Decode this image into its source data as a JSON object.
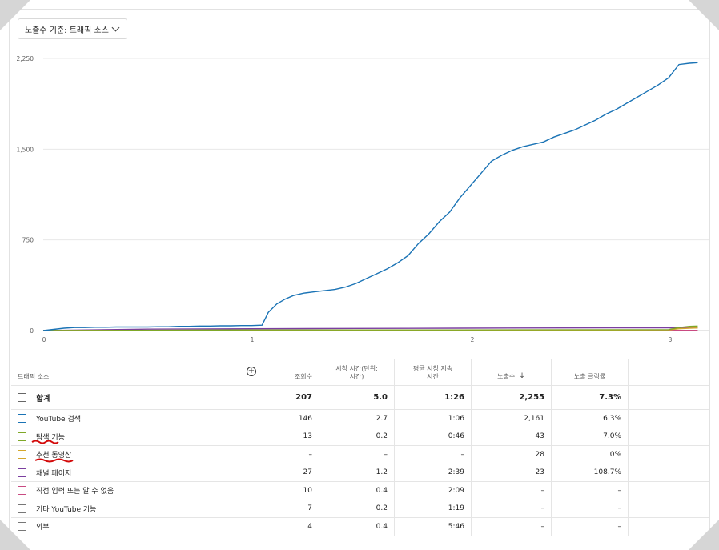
{
  "dropdown": {
    "label": "노출수 기준: 트래픽 소스"
  },
  "chart_data": {
    "type": "line",
    "y_ticks": [
      "2,250",
      "1,500",
      "750",
      "0"
    ],
    "x_ticks": [
      "0",
      "1",
      "2",
      "3"
    ],
    "ylim": [
      0,
      2250
    ],
    "xlim": [
      0,
      3.15
    ],
    "grid": true,
    "series": [
      {
        "key": "youtube_search",
        "color": "#1a73b5",
        "x": [
          0,
          0.05,
          0.1,
          0.15,
          0.2,
          0.25,
          0.3,
          0.35,
          0.4,
          0.45,
          0.5,
          0.55,
          0.6,
          0.65,
          0.7,
          0.75,
          0.8,
          0.85,
          0.9,
          0.95,
          1.0,
          1.05,
          1.08,
          1.12,
          1.16,
          1.2,
          1.25,
          1.3,
          1.35,
          1.4,
          1.45,
          1.5,
          1.55,
          1.6,
          1.65,
          1.7,
          1.75,
          1.8,
          1.85,
          1.9,
          1.95,
          2.0,
          2.05,
          2.1,
          2.15,
          2.2,
          2.25,
          2.3,
          2.35,
          2.4,
          2.45,
          2.5,
          2.55,
          2.6,
          2.65,
          2.7,
          2.75,
          2.8,
          2.85,
          2.9,
          2.95,
          3.0,
          3.05,
          3.1,
          3.14
        ],
        "y": [
          0,
          10,
          20,
          25,
          25,
          28,
          28,
          30,
          30,
          30,
          30,
          32,
          32,
          35,
          35,
          38,
          38,
          40,
          40,
          42,
          42,
          45,
          150,
          220,
          260,
          290,
          310,
          320,
          330,
          340,
          360,
          390,
          430,
          470,
          510,
          560,
          620,
          720,
          800,
          900,
          980,
          1100,
          1200,
          1300,
          1400,
          1450,
          1490,
          1520,
          1540,
          1560,
          1600,
          1630,
          1660,
          1700,
          1740,
          1790,
          1830,
          1880,
          1930,
          1980,
          2030,
          2090,
          2200,
          2210,
          2215
        ]
      },
      {
        "key": "browse_features",
        "color": "#7fa828",
        "x": [
          0,
          1.0,
          2.0,
          3.0,
          3.05,
          3.1,
          3.14
        ],
        "y": [
          0,
          5,
          5,
          8,
          25,
          35,
          38
        ]
      },
      {
        "key": "suggested_videos",
        "color": "#d4a72c",
        "x": [
          0,
          1.0,
          2.0,
          3.0,
          3.05,
          3.1,
          3.14
        ],
        "y": [
          0,
          3,
          3,
          5,
          15,
          20,
          22
        ]
      },
      {
        "key": "channel_pages",
        "color": "#7b3fa0",
        "x": [
          0,
          0.5,
          1.0,
          1.5,
          2.0,
          2.5,
          3.0,
          3.14
        ],
        "y": [
          0,
          12,
          15,
          18,
          20,
          22,
          23,
          23
        ]
      },
      {
        "key": "direct_or_unknown",
        "color": "#c94a82",
        "x": [
          0,
          1.0,
          2.0,
          3.14
        ],
        "y": [
          0,
          2,
          2,
          2
        ]
      }
    ]
  },
  "table": {
    "headers": {
      "source": "트래픽 소스",
      "views": "조회수",
      "watch_time_l1": "시청 시간(단위:",
      "watch_time_l2": "시간)",
      "avg_view_l1": "평균 시청 지속",
      "avg_view_l2": "시간",
      "impressions": "노출수",
      "ctr": "노출 클릭률"
    },
    "total": {
      "name": "합계",
      "views": "207",
      "watch": "5.0",
      "avg": "1:26",
      "impressions": "2,255",
      "ctr": "7.3%"
    },
    "rows": [
      {
        "name": "YouTube 검색",
        "color": "#1a73b5",
        "views": "146",
        "watch": "2.7",
        "avg": "1:06",
        "impressions": "2,161",
        "ctr": "6.3%"
      },
      {
        "name": "탐색 기능",
        "color": "#7fa828",
        "views": "13",
        "watch": "0.2",
        "avg": "0:46",
        "impressions": "43",
        "ctr": "7.0%"
      },
      {
        "name": "추천 동영상",
        "color": "#d4a72c",
        "views": "–",
        "watch": "–",
        "avg": "–",
        "impressions": "28",
        "ctr": "0%"
      },
      {
        "name": "채널 페이지",
        "color": "#7b3fa0",
        "views": "27",
        "watch": "1.2",
        "avg": "2:39",
        "impressions": "23",
        "ctr": "108.7%"
      },
      {
        "name": "직접 입력 또는 알 수 없음",
        "color": "#c94a82",
        "views": "10",
        "watch": "0.4",
        "avg": "2:09",
        "impressions": "–",
        "ctr": "–"
      },
      {
        "name": "기타 YouTube 기능",
        "color": "#777777",
        "views": "7",
        "watch": "0.2",
        "avg": "1:19",
        "impressions": "–",
        "ctr": "–"
      },
      {
        "name": "외부",
        "color": "#777777",
        "views": "4",
        "watch": "0.4",
        "avg": "5:46",
        "impressions": "–",
        "ctr": "–"
      }
    ]
  },
  "colors": {
    "grid": "#e8e8e8",
    "baseline": "#cccccc",
    "annotation": "#d30a0a"
  }
}
